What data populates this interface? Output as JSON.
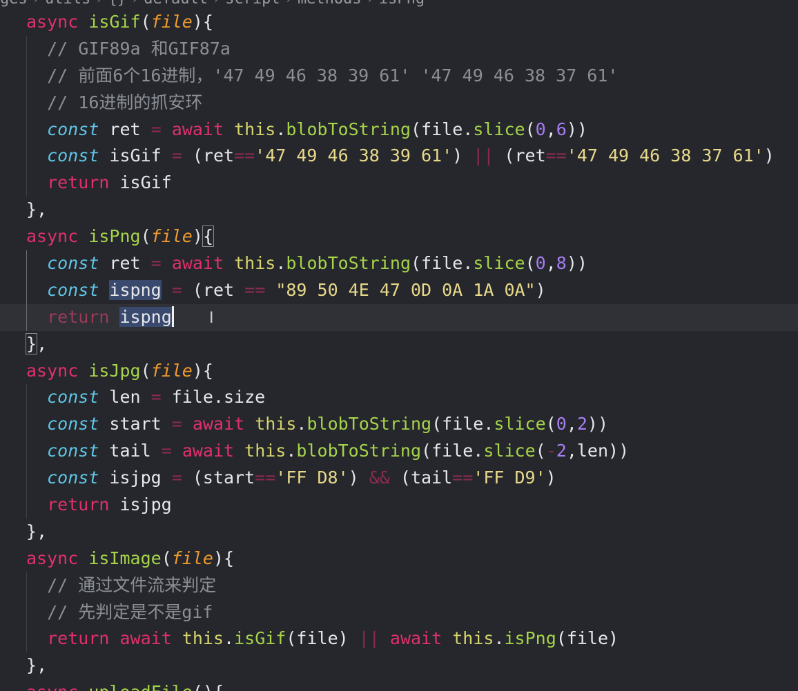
{
  "breadcrumb": {
    "items": [
      "ges",
      "utils",
      "{}",
      "default",
      "script",
      "methods",
      "isPng"
    ]
  },
  "editor": {
    "lines": [
      {
        "tokens": [
          [
            "kw",
            "async"
          ],
          [
            "sp",
            " "
          ],
          [
            "fn",
            "isGif"
          ],
          [
            "w",
            "("
          ],
          [
            "param",
            "file"
          ],
          [
            "w",
            "){"
          ]
        ],
        "indent": 0
      },
      {
        "tokens": [
          [
            "cm",
            "// GIF89a 和GIF87a"
          ]
        ],
        "indent": 1
      },
      {
        "tokens": [
          [
            "cm",
            "// 前面6个16进制，'47 49 46 38 39 61' '47 49 46 38 37 61'"
          ]
        ],
        "indent": 1
      },
      {
        "tokens": [
          [
            "cm",
            "// 16进制的抓安环"
          ]
        ],
        "indent": 1
      },
      {
        "tokens": [
          [
            "const",
            "const"
          ],
          [
            "w",
            " ret "
          ],
          [
            "op",
            "="
          ],
          [
            "w",
            " "
          ],
          [
            "kw",
            "await"
          ],
          [
            "w",
            " "
          ],
          [
            "this",
            "this"
          ],
          [
            "w",
            "."
          ],
          [
            "fn",
            "blobToString"
          ],
          [
            "w",
            "(file."
          ],
          [
            "fn",
            "slice"
          ],
          [
            "w",
            "("
          ],
          [
            "num",
            "0"
          ],
          [
            "w",
            ","
          ],
          [
            "num",
            "6"
          ],
          [
            "w",
            "))"
          ]
        ],
        "indent": 1
      },
      {
        "tokens": [
          [
            "const",
            "const"
          ],
          [
            "w",
            " isGif "
          ],
          [
            "op",
            "="
          ],
          [
            "w",
            " (ret"
          ],
          [
            "op",
            "=="
          ],
          [
            "str",
            "'47 49 46 38 39 61'"
          ],
          [
            "w",
            ") "
          ],
          [
            "op",
            "||"
          ],
          [
            "w",
            " (ret"
          ],
          [
            "op",
            "=="
          ],
          [
            "str",
            "'47 49 46 38 37 61'"
          ],
          [
            "w",
            ")"
          ]
        ],
        "indent": 1
      },
      {
        "tokens": [
          [
            "kw",
            "return"
          ],
          [
            "w",
            " isGif"
          ]
        ],
        "indent": 1
      },
      {
        "tokens": [
          [
            "w",
            "},"
          ]
        ],
        "indent": 0
      },
      {
        "tokens": [
          [
            "kw",
            "async"
          ],
          [
            "sp",
            " "
          ],
          [
            "fn",
            "isPng"
          ],
          [
            "w",
            "("
          ],
          [
            "param",
            "file"
          ],
          [
            "w",
            ")"
          ],
          [
            "box",
            "{"
          ]
        ],
        "indent": 0
      },
      {
        "tokens": [
          [
            "const",
            "const"
          ],
          [
            "w",
            " ret "
          ],
          [
            "op",
            "="
          ],
          [
            "w",
            " "
          ],
          [
            "kw",
            "await"
          ],
          [
            "w",
            " "
          ],
          [
            "this",
            "this"
          ],
          [
            "w",
            "."
          ],
          [
            "fn",
            "blobToString"
          ],
          [
            "w",
            "(file."
          ],
          [
            "fn",
            "slice"
          ],
          [
            "w",
            "("
          ],
          [
            "num",
            "0"
          ],
          [
            "w",
            ","
          ],
          [
            "num",
            "8"
          ],
          [
            "w",
            "))"
          ]
        ],
        "indent": 1
      },
      {
        "tokens": [
          [
            "const",
            "const"
          ],
          [
            "w",
            " "
          ],
          [
            "sel",
            "ispng"
          ],
          [
            "w",
            " "
          ],
          [
            "op",
            "="
          ],
          [
            "w",
            " (ret "
          ],
          [
            "op",
            "=="
          ],
          [
            "w",
            " "
          ],
          [
            "str",
            "\"89 50 4E 47 0D 0A 1A 0A\""
          ],
          [
            "w",
            ")"
          ]
        ],
        "indent": 1
      },
      {
        "tokens": [
          [
            "kwdim",
            "return"
          ],
          [
            "w",
            " "
          ],
          [
            "sel",
            "ispng"
          ],
          [
            "cursor",
            ""
          ]
        ],
        "indent": 1,
        "current": true
      },
      {
        "tokens": [
          [
            "box",
            "}"
          ],
          [
            "w",
            ","
          ]
        ],
        "indent": 0
      },
      {
        "tokens": [
          [
            "kw",
            "async"
          ],
          [
            "sp",
            " "
          ],
          [
            "fn",
            "isJpg"
          ],
          [
            "w",
            "("
          ],
          [
            "param",
            "file"
          ],
          [
            "w",
            "){"
          ]
        ],
        "indent": 0
      },
      {
        "tokens": [
          [
            "const",
            "const"
          ],
          [
            "w",
            " len "
          ],
          [
            "op",
            "="
          ],
          [
            "w",
            " file.size"
          ]
        ],
        "indent": 1
      },
      {
        "tokens": [
          [
            "const",
            "const"
          ],
          [
            "w",
            " start "
          ],
          [
            "op",
            "="
          ],
          [
            "w",
            " "
          ],
          [
            "kw",
            "await"
          ],
          [
            "w",
            " "
          ],
          [
            "this",
            "this"
          ],
          [
            "w",
            "."
          ],
          [
            "fn",
            "blobToString"
          ],
          [
            "w",
            "(file."
          ],
          [
            "fn",
            "slice"
          ],
          [
            "w",
            "("
          ],
          [
            "num",
            "0"
          ],
          [
            "w",
            ","
          ],
          [
            "num",
            "2"
          ],
          [
            "w",
            "))"
          ]
        ],
        "indent": 1
      },
      {
        "tokens": [
          [
            "const",
            "const"
          ],
          [
            "w",
            " tail "
          ],
          [
            "op",
            "="
          ],
          [
            "w",
            " "
          ],
          [
            "kw",
            "await"
          ],
          [
            "w",
            " "
          ],
          [
            "this",
            "this"
          ],
          [
            "w",
            "."
          ],
          [
            "fn",
            "blobToString"
          ],
          [
            "w",
            "(file."
          ],
          [
            "fn",
            "slice"
          ],
          [
            "w",
            "("
          ],
          [
            "op",
            "-"
          ],
          [
            "num",
            "2"
          ],
          [
            "w",
            ",len))"
          ]
        ],
        "indent": 1
      },
      {
        "tokens": [
          [
            "const",
            "const"
          ],
          [
            "w",
            " isjpg "
          ],
          [
            "op",
            "="
          ],
          [
            "w",
            " (start"
          ],
          [
            "op",
            "=="
          ],
          [
            "str",
            "'FF D8'"
          ],
          [
            "w",
            ") "
          ],
          [
            "op",
            "&&"
          ],
          [
            "w",
            " (tail"
          ],
          [
            "op",
            "=="
          ],
          [
            "str",
            "'FF D9'"
          ],
          [
            "w",
            ")"
          ]
        ],
        "indent": 1
      },
      {
        "tokens": [
          [
            "kw",
            "return"
          ],
          [
            "w",
            " isjpg"
          ]
        ],
        "indent": 1
      },
      {
        "tokens": [
          [
            "w",
            "},"
          ]
        ],
        "indent": 0
      },
      {
        "tokens": [
          [
            "kw",
            "async"
          ],
          [
            "sp",
            " "
          ],
          [
            "fn",
            "isImage"
          ],
          [
            "w",
            "("
          ],
          [
            "param",
            "file"
          ],
          [
            "w",
            "){"
          ]
        ],
        "indent": 0
      },
      {
        "tokens": [
          [
            "cm",
            "// 通过文件流来判定"
          ]
        ],
        "indent": 1
      },
      {
        "tokens": [
          [
            "cm",
            "// 先判定是不是gif"
          ]
        ],
        "indent": 1
      },
      {
        "tokens": [
          [
            "kw",
            "return"
          ],
          [
            "w",
            " "
          ],
          [
            "kw",
            "await"
          ],
          [
            "w",
            " "
          ],
          [
            "this",
            "this"
          ],
          [
            "w",
            "."
          ],
          [
            "fn",
            "isGif"
          ],
          [
            "w",
            "(file) "
          ],
          [
            "op",
            "||"
          ],
          [
            "w",
            " "
          ],
          [
            "kw",
            "await"
          ],
          [
            "w",
            " "
          ],
          [
            "this",
            "this"
          ],
          [
            "w",
            "."
          ],
          [
            "fn",
            "isPng"
          ],
          [
            "w",
            "(file)"
          ]
        ],
        "indent": 1
      },
      {
        "tokens": [
          [
            "w",
            "},"
          ]
        ],
        "indent": 0
      },
      {
        "tokens": [
          [
            "kw",
            "async"
          ],
          [
            "sp",
            " "
          ],
          [
            "fn",
            "uploadFile"
          ],
          [
            "w",
            "(){"
          ]
        ],
        "indent": 0
      }
    ]
  },
  "colors": {
    "background": "#25272c",
    "keyword": "#e0306b",
    "function": "#a6d44a",
    "param": "#f19b2c",
    "const": "#5fc6e6",
    "string": "#e8d98a",
    "number": "#a77df2",
    "comment": "#8b8e95"
  }
}
